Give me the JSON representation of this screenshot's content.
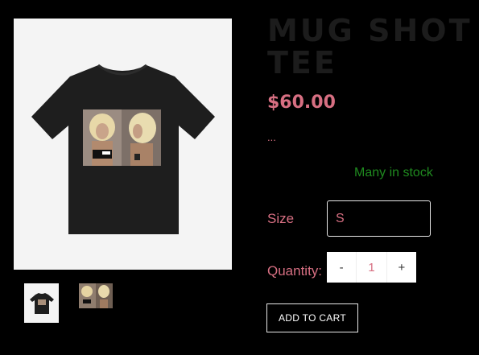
{
  "product": {
    "title": "MUG SHOT TEE",
    "price": "$60.00",
    "description": "...",
    "stock": "Many in stock"
  },
  "gallery": {
    "main_image": "tshirt-photo-print",
    "thumbnails": [
      "tshirt-thumb",
      "photo-print-thumb"
    ]
  },
  "size": {
    "label": "Size",
    "selected": "S"
  },
  "quantity": {
    "label": "Quantity:",
    "minus": "-",
    "value": "1",
    "plus": "+"
  },
  "cart": {
    "add_label": "ADD TO CART"
  },
  "colors": {
    "background": "#000000",
    "accent_pink": "#d76f82",
    "stock_green": "#1f8a1f",
    "title_dark": "#1c1c1c"
  }
}
